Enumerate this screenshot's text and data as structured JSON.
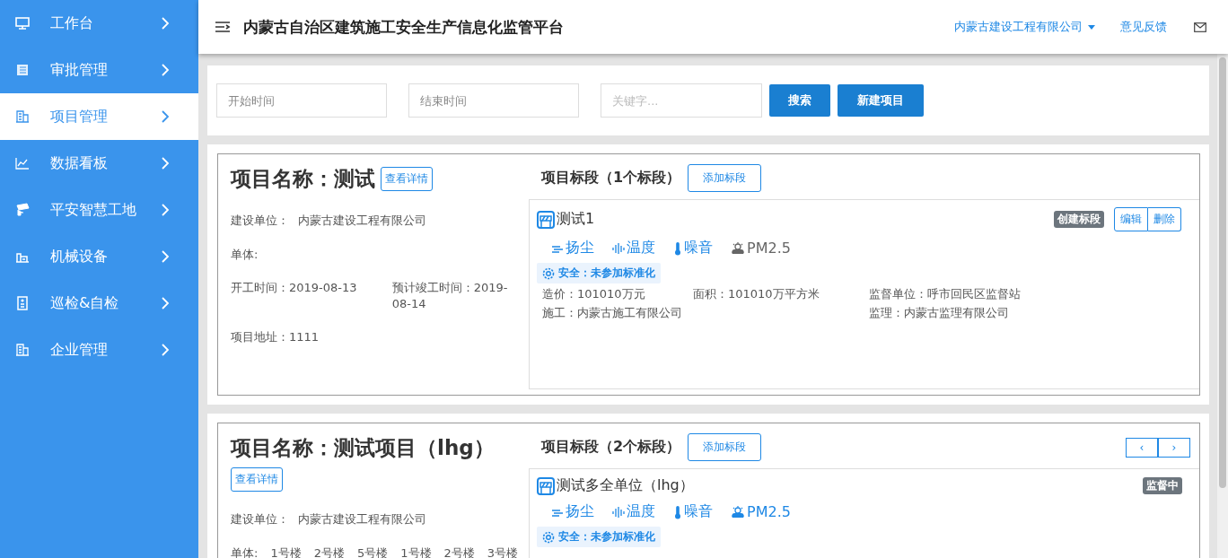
{
  "sidebar": {
    "items": [
      {
        "label": "工作台",
        "kind": "monitor",
        "selected": false
      },
      {
        "label": "审批管理",
        "kind": "list",
        "selected": false
      },
      {
        "label": "项目管理",
        "kind": "building",
        "selected": true
      },
      {
        "label": "数据看板",
        "kind": "chart",
        "selected": false
      },
      {
        "label": "平安智慧工地",
        "kind": "camera",
        "selected": false
      },
      {
        "label": "机械设备",
        "kind": "machine",
        "selected": false
      },
      {
        "label": "巡检&自检",
        "kind": "doc",
        "selected": false
      },
      {
        "label": "企业管理",
        "kind": "building",
        "selected": false
      }
    ]
  },
  "header": {
    "title": "内蒙古自治区建筑施工安全生产信息化监管平台",
    "company": "内蒙古建设工程有限公司",
    "feedback": "意见反馈"
  },
  "filters": {
    "start": {
      "placeholder": "开始时间"
    },
    "end": {
      "placeholder": "结束时间"
    },
    "keyword": {
      "placeholder": "关键字..."
    },
    "search_button": "搜索",
    "new_button": "新建项目"
  },
  "projects": [
    {
      "title": "项目名称：测试",
      "detail_button": "查看详情",
      "builder_label": "建设单位：",
      "builder": "内蒙古建设工程有限公司",
      "units_label": "单体:",
      "start": "开工时间：2019-08-13",
      "finish": "预计竣工时间：2019-08-14",
      "address": "项目地址：1111",
      "sections_title": "项目标段（1个标段）",
      "add_button": "添加标段",
      "sections": [
        {
          "name": "测试1",
          "status": "创建标段",
          "actions": [
            "编辑",
            "删除"
          ],
          "sensors": [
            {
              "kind": "dust",
              "label": "扬尘",
              "active": true
            },
            {
              "kind": "temperature",
              "label": "温度",
              "active": true
            },
            {
              "kind": "noise",
              "label": "噪音",
              "active": true
            },
            {
              "kind": "pm",
              "label": "PM2.5",
              "active": false
            }
          ],
          "safety": "安全：未参加标准化",
          "fields": [
            {
              "text": "造价：101010万元",
              "wide": false
            },
            {
              "text": "面积：101010万平方米",
              "wide": false
            },
            {
              "text": "监督单位：呼市回民区监督站",
              "wide": false
            },
            {
              "text": "施工：内蒙古施工有限公司",
              "wide": true
            },
            {
              "text": "监理：内蒙古监理有限公司",
              "wide": false
            }
          ]
        }
      ]
    },
    {
      "title": "项目名称：测试项目（lhg）",
      "detail_button": "查看详情",
      "builder_label": "建设单位：",
      "builder": "内蒙古建设工程有限公司",
      "units_label": "单体:",
      "units": [
        "1号楼",
        "2号楼",
        "5号楼",
        "1号楼",
        "2号楼",
        "3号楼"
      ],
      "sections_title": "项目标段（2个标段）",
      "add_button": "添加标段",
      "pager": [
        "‹",
        "›"
      ],
      "sections": [
        {
          "name": "测试多全单位（lhg）",
          "status": "监督中",
          "sensors": [
            {
              "kind": "dust",
              "label": "扬尘",
              "active": true
            },
            {
              "kind": "temperature",
              "label": "温度",
              "active": true
            },
            {
              "kind": "noise",
              "label": "噪音",
              "active": true
            },
            {
              "kind": "pm",
              "label": "PM2.5",
              "active": true
            }
          ],
          "safety": "安全：未参加标准化"
        }
      ]
    }
  ]
}
